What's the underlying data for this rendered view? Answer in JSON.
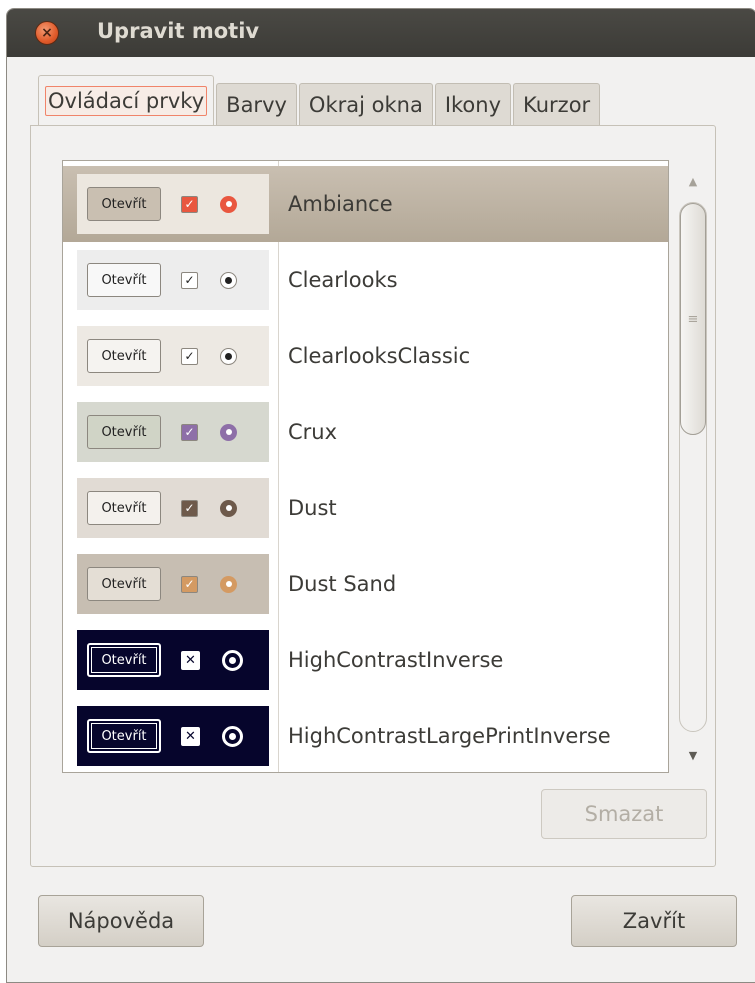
{
  "window": {
    "title": "Upravit motiv",
    "close_glyph": "×"
  },
  "tabs": [
    {
      "label": "Ovládací prvky",
      "active": true
    },
    {
      "label": "Barvy",
      "active": false
    },
    {
      "label": "Okraj okna",
      "active": false
    },
    {
      "label": "Ikony",
      "active": false
    },
    {
      "label": "Kurzor",
      "active": false
    }
  ],
  "themes": {
    "preview_button_label": "Otevřít",
    "items": [
      {
        "name": "Ambiance",
        "selected": true,
        "preview_bg": "#ece7df",
        "button_bg": "#c9bfb1",
        "check_color": "#e9573f",
        "radio_color": "#e9573f"
      },
      {
        "name": "Clearlooks",
        "selected": false,
        "preview_bg": "#ededed",
        "button_bg": "#f8f8f8",
        "check_color": "#222222",
        "radio_color": "#222222"
      },
      {
        "name": "ClearlooksClassic",
        "selected": false,
        "preview_bg": "#ede9e3",
        "button_bg": "#f5f3f0",
        "check_color": "#222222",
        "radio_color": "#222222"
      },
      {
        "name": "Crux",
        "selected": false,
        "preview_bg": "#d6d8cf",
        "button_bg": "#d0d4c6",
        "check_color": "#8e6fa8",
        "radio_color": "#8e6fa8"
      },
      {
        "name": "Dust",
        "selected": false,
        "preview_bg": "#e1dbd4",
        "button_bg": "#f4f1ed",
        "check_color": "#6e5a4b",
        "radio_color": "#6e5a4b"
      },
      {
        "name": "Dust Sand",
        "selected": false,
        "preview_bg": "#c7beb2",
        "button_bg": "#e4ded5",
        "check_color": "#d49a62",
        "radio_color": "#d49a62"
      },
      {
        "name": "HighContrastInverse",
        "selected": false,
        "preview_bg": "#06052c",
        "button_bg": "#06052c",
        "check_color": "#ffffff",
        "radio_color": "#ffffff"
      },
      {
        "name": "HighContrastLargePrintInverse",
        "selected": false,
        "preview_bg": "#06052c",
        "button_bg": "#06052c",
        "check_color": "#ffffff",
        "radio_color": "#ffffff"
      }
    ]
  },
  "scrollbar": {
    "up_glyph": "▲",
    "down_glyph": "▼",
    "grip_glyph": "≡"
  },
  "buttons": {
    "delete": "Smazat",
    "help": "Nápověda",
    "close": "Zavřít"
  }
}
